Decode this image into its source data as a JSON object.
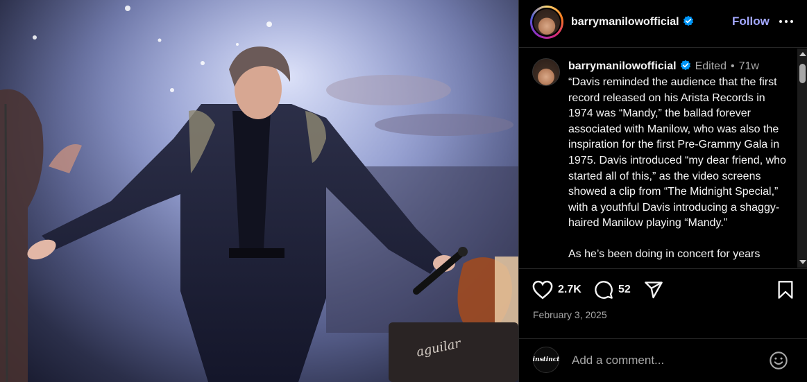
{
  "post": {
    "image_alt": "Barry Manilow on stage holding a microphone",
    "amp_brand": "aguilar"
  },
  "header": {
    "username": "barrymanilowofficial",
    "follow_label": "Follow",
    "more_icon": "more-horizontal-icon"
  },
  "caption": {
    "username": "barrymanilowofficial",
    "edited_label": "Edited",
    "separator": "•",
    "age": "71w",
    "paragraphs": [
      "“Davis reminded the audience that the first record released on his Arista Records in 1974 was “Mandy,” the ballad forever associated with Manilow, who was also the inspiration for the first Pre-Grammy Gala in 1975. Davis introduced “my dear friend, who started all of this,” as the video screens showed a clip from “The Midnight Special,” with a youthful Davis introducing a shaggy-haired Manilow playing “Mandy.”",
      "As he’s been doing in concert for years"
    ]
  },
  "actions": {
    "likes": "2.7K",
    "comments": "52",
    "date": "February 3, 2025"
  },
  "comment_box": {
    "avatar_text": "instinct",
    "placeholder": "Add a comment..."
  },
  "colors": {
    "accent": "#a3a8ff",
    "verified": "#0095f6",
    "muted": "#a8a8a8"
  }
}
